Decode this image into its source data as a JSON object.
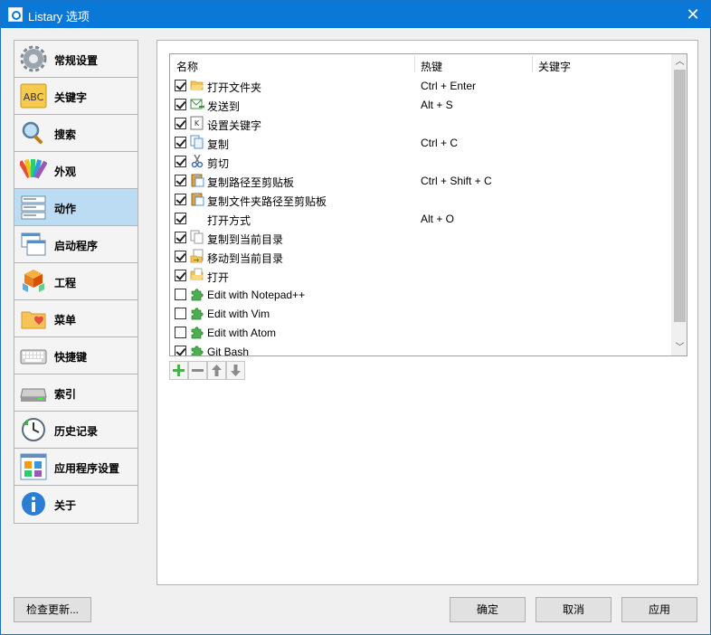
{
  "window": {
    "title": "Listary 选项",
    "close_glyph": "✕"
  },
  "sidebar": {
    "items": [
      {
        "label": "常规设置",
        "icon": "gear-icon"
      },
      {
        "label": "关键字",
        "icon": "abc-icon"
      },
      {
        "label": "搜索",
        "icon": "magnifier-icon"
      },
      {
        "label": "外观",
        "icon": "palette-icon"
      },
      {
        "label": "动作",
        "icon": "actions-list-icon",
        "selected": true
      },
      {
        "label": "启动程序",
        "icon": "windows-icon"
      },
      {
        "label": "工程",
        "icon": "cubes-icon"
      },
      {
        "label": "菜单",
        "icon": "folder-heart-icon"
      },
      {
        "label": "快捷键",
        "icon": "keyboard-icon"
      },
      {
        "label": "索引",
        "icon": "drive-icon"
      },
      {
        "label": "历史记录",
        "icon": "clock-icon"
      },
      {
        "label": "应用程序设置",
        "icon": "app-grid-icon"
      },
      {
        "label": "关于",
        "icon": "info-icon"
      }
    ]
  },
  "actions_list": {
    "columns": [
      "名称",
      "热键",
      "关键字"
    ],
    "rows": [
      {
        "checked": true,
        "icon": "folder-open-icon",
        "name": "打开文件夹",
        "hotkey": "Ctrl + Enter"
      },
      {
        "checked": true,
        "icon": "send-mail-icon",
        "name": "发送到",
        "hotkey": "Alt + S"
      },
      {
        "checked": true,
        "icon": "keyword-k-icon",
        "name": "设置关键字",
        "hotkey": ""
      },
      {
        "checked": true,
        "icon": "copy-icon",
        "name": "复制",
        "hotkey": "Ctrl + C"
      },
      {
        "checked": true,
        "icon": "scissors-icon",
        "name": "剪切",
        "hotkey": ""
      },
      {
        "checked": true,
        "icon": "clipboard-icon",
        "name": "复制路径至剪贴板",
        "hotkey": "Ctrl + Shift + C"
      },
      {
        "checked": true,
        "icon": "clipboard-icon",
        "name": "复制文件夹路径至剪贴板",
        "hotkey": ""
      },
      {
        "checked": true,
        "icon": "",
        "name": "打开方式",
        "hotkey": "Alt + O"
      },
      {
        "checked": true,
        "icon": "copy-here-icon",
        "name": "复制到当前目录",
        "hotkey": ""
      },
      {
        "checked": true,
        "icon": "move-here-icon",
        "name": "移动到当前目录",
        "hotkey": ""
      },
      {
        "checked": true,
        "icon": "open-folder-icon",
        "name": "打开",
        "hotkey": ""
      },
      {
        "checked": false,
        "icon": "plugin-puzzle-icon",
        "name": "Edit with Notepad++",
        "hotkey": ""
      },
      {
        "checked": false,
        "icon": "plugin-puzzle-icon",
        "name": "Edit with Vim",
        "hotkey": ""
      },
      {
        "checked": false,
        "icon": "plugin-puzzle-icon",
        "name": "Edit with Atom",
        "hotkey": ""
      },
      {
        "checked": true,
        "icon": "plugin-puzzle-icon",
        "name": "Git Bash",
        "hotkey": ""
      }
    ]
  },
  "list_toolbar": {
    "buttons": [
      "add-icon",
      "remove-icon",
      "move-up-icon",
      "move-down-icon"
    ]
  },
  "footer": {
    "check_updates": "检查更新...",
    "ok": "确定",
    "cancel": "取消",
    "apply": "应用"
  },
  "colors": {
    "titlebar": "#0a78d7",
    "selected_nav": "#bcdcf4",
    "plugin_green": "#4caf50"
  }
}
